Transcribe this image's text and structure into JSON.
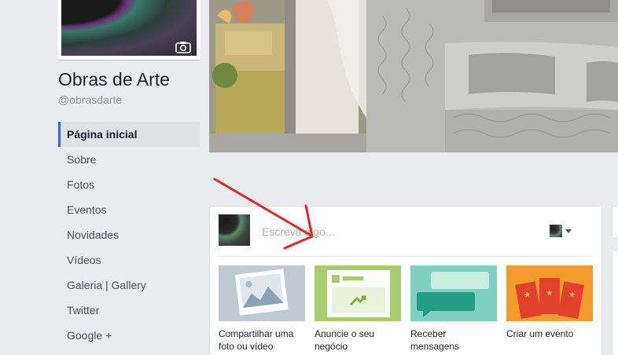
{
  "page": {
    "title": "Obras de Arte",
    "handle": "@obrasdarte"
  },
  "sidebar": {
    "items": [
      {
        "label": "Página inicial",
        "active": true
      },
      {
        "label": "Sobre"
      },
      {
        "label": "Fotos"
      },
      {
        "label": "Eventos"
      },
      {
        "label": "Novidades"
      },
      {
        "label": "Vídeos"
      },
      {
        "label": "Galeria | Gallery"
      },
      {
        "label": "Twitter"
      },
      {
        "label": "Google +"
      }
    ]
  },
  "composer": {
    "placeholder": "Escreva algo...",
    "tiles": [
      {
        "label": "Compartilhar uma foto ou vídeo",
        "icon": "photo-icon"
      },
      {
        "label": "Anuncie o seu negócio",
        "icon": "advertise-icon"
      },
      {
        "label": "Receber mensagens",
        "icon": "messages-icon"
      },
      {
        "label": "Criar um evento",
        "icon": "event-icon"
      }
    ]
  },
  "colors": {
    "accent": "#4267b2",
    "annotation": "#e0282a",
    "tile_photo": "#bfcad3",
    "tile_ad": "#a8cc6f",
    "tile_messages": "#7fd0c0",
    "tile_event": "#f49b2f"
  }
}
